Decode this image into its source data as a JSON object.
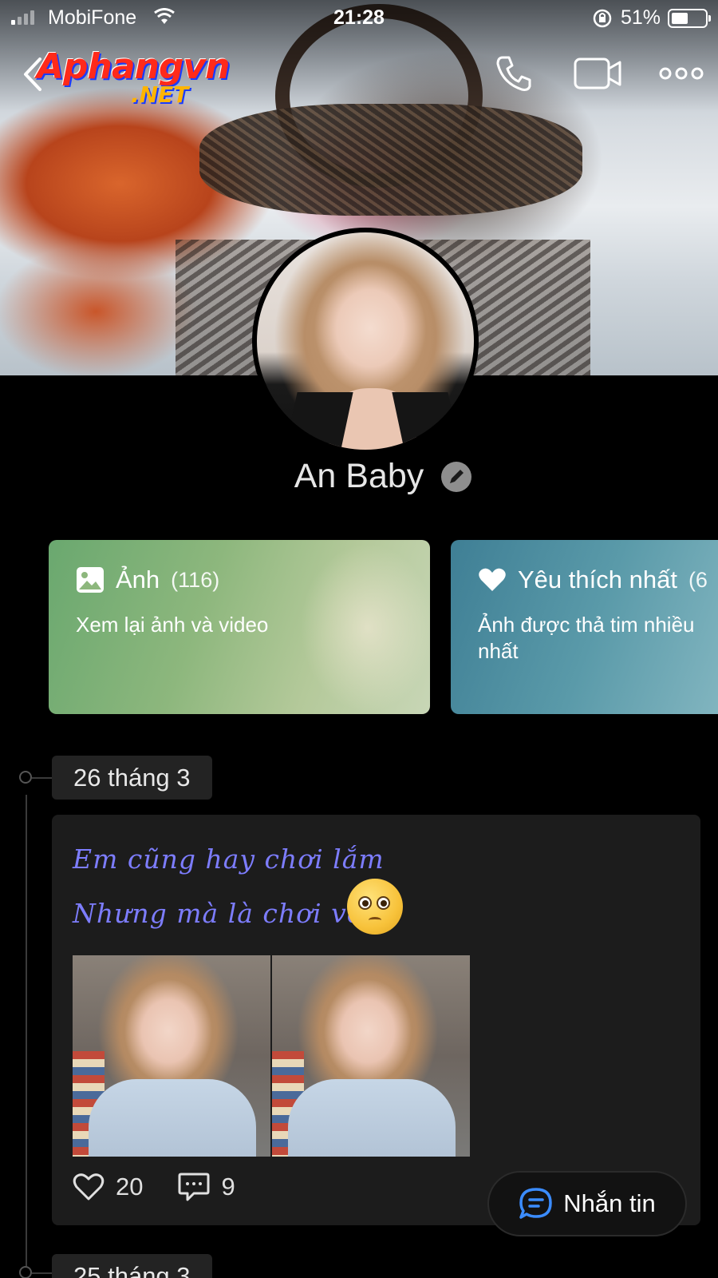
{
  "status_bar": {
    "carrier": "MobiFone",
    "time": "21:28",
    "battery_percent": "51%",
    "battery_level": 0.51
  },
  "header": {
    "logo_line1": "Aphangvn",
    "logo_line2": ".NET",
    "icons": [
      "back-icon",
      "phone-icon",
      "video-call-icon",
      "more-icon"
    ]
  },
  "profile": {
    "name": "An Baby"
  },
  "albums": [
    {
      "title": "Ảnh",
      "count": "(116)",
      "subtitle": "Xem lại ảnh và video",
      "icon": "image-icon"
    },
    {
      "title": "Yêu thích nhất",
      "count": "(6",
      "subtitle": "Ảnh được thả tim nhiều nhất",
      "icon": "heart-icon"
    }
  ],
  "timeline": [
    {
      "date": "26 tháng 3",
      "caption_line1": "Em cũng hay chơi lắm",
      "caption_line2": "Nhưng mà là chơi vơi...",
      "likes": "20",
      "comments": "9"
    },
    {
      "date": "25 tháng 3"
    }
  ],
  "message_button": {
    "label": "Nhắn tin"
  },
  "colors": {
    "background": "#000000",
    "caption": "#7d7dff",
    "card_photos": "#8db77d",
    "card_fav": "#4f8ea1"
  }
}
